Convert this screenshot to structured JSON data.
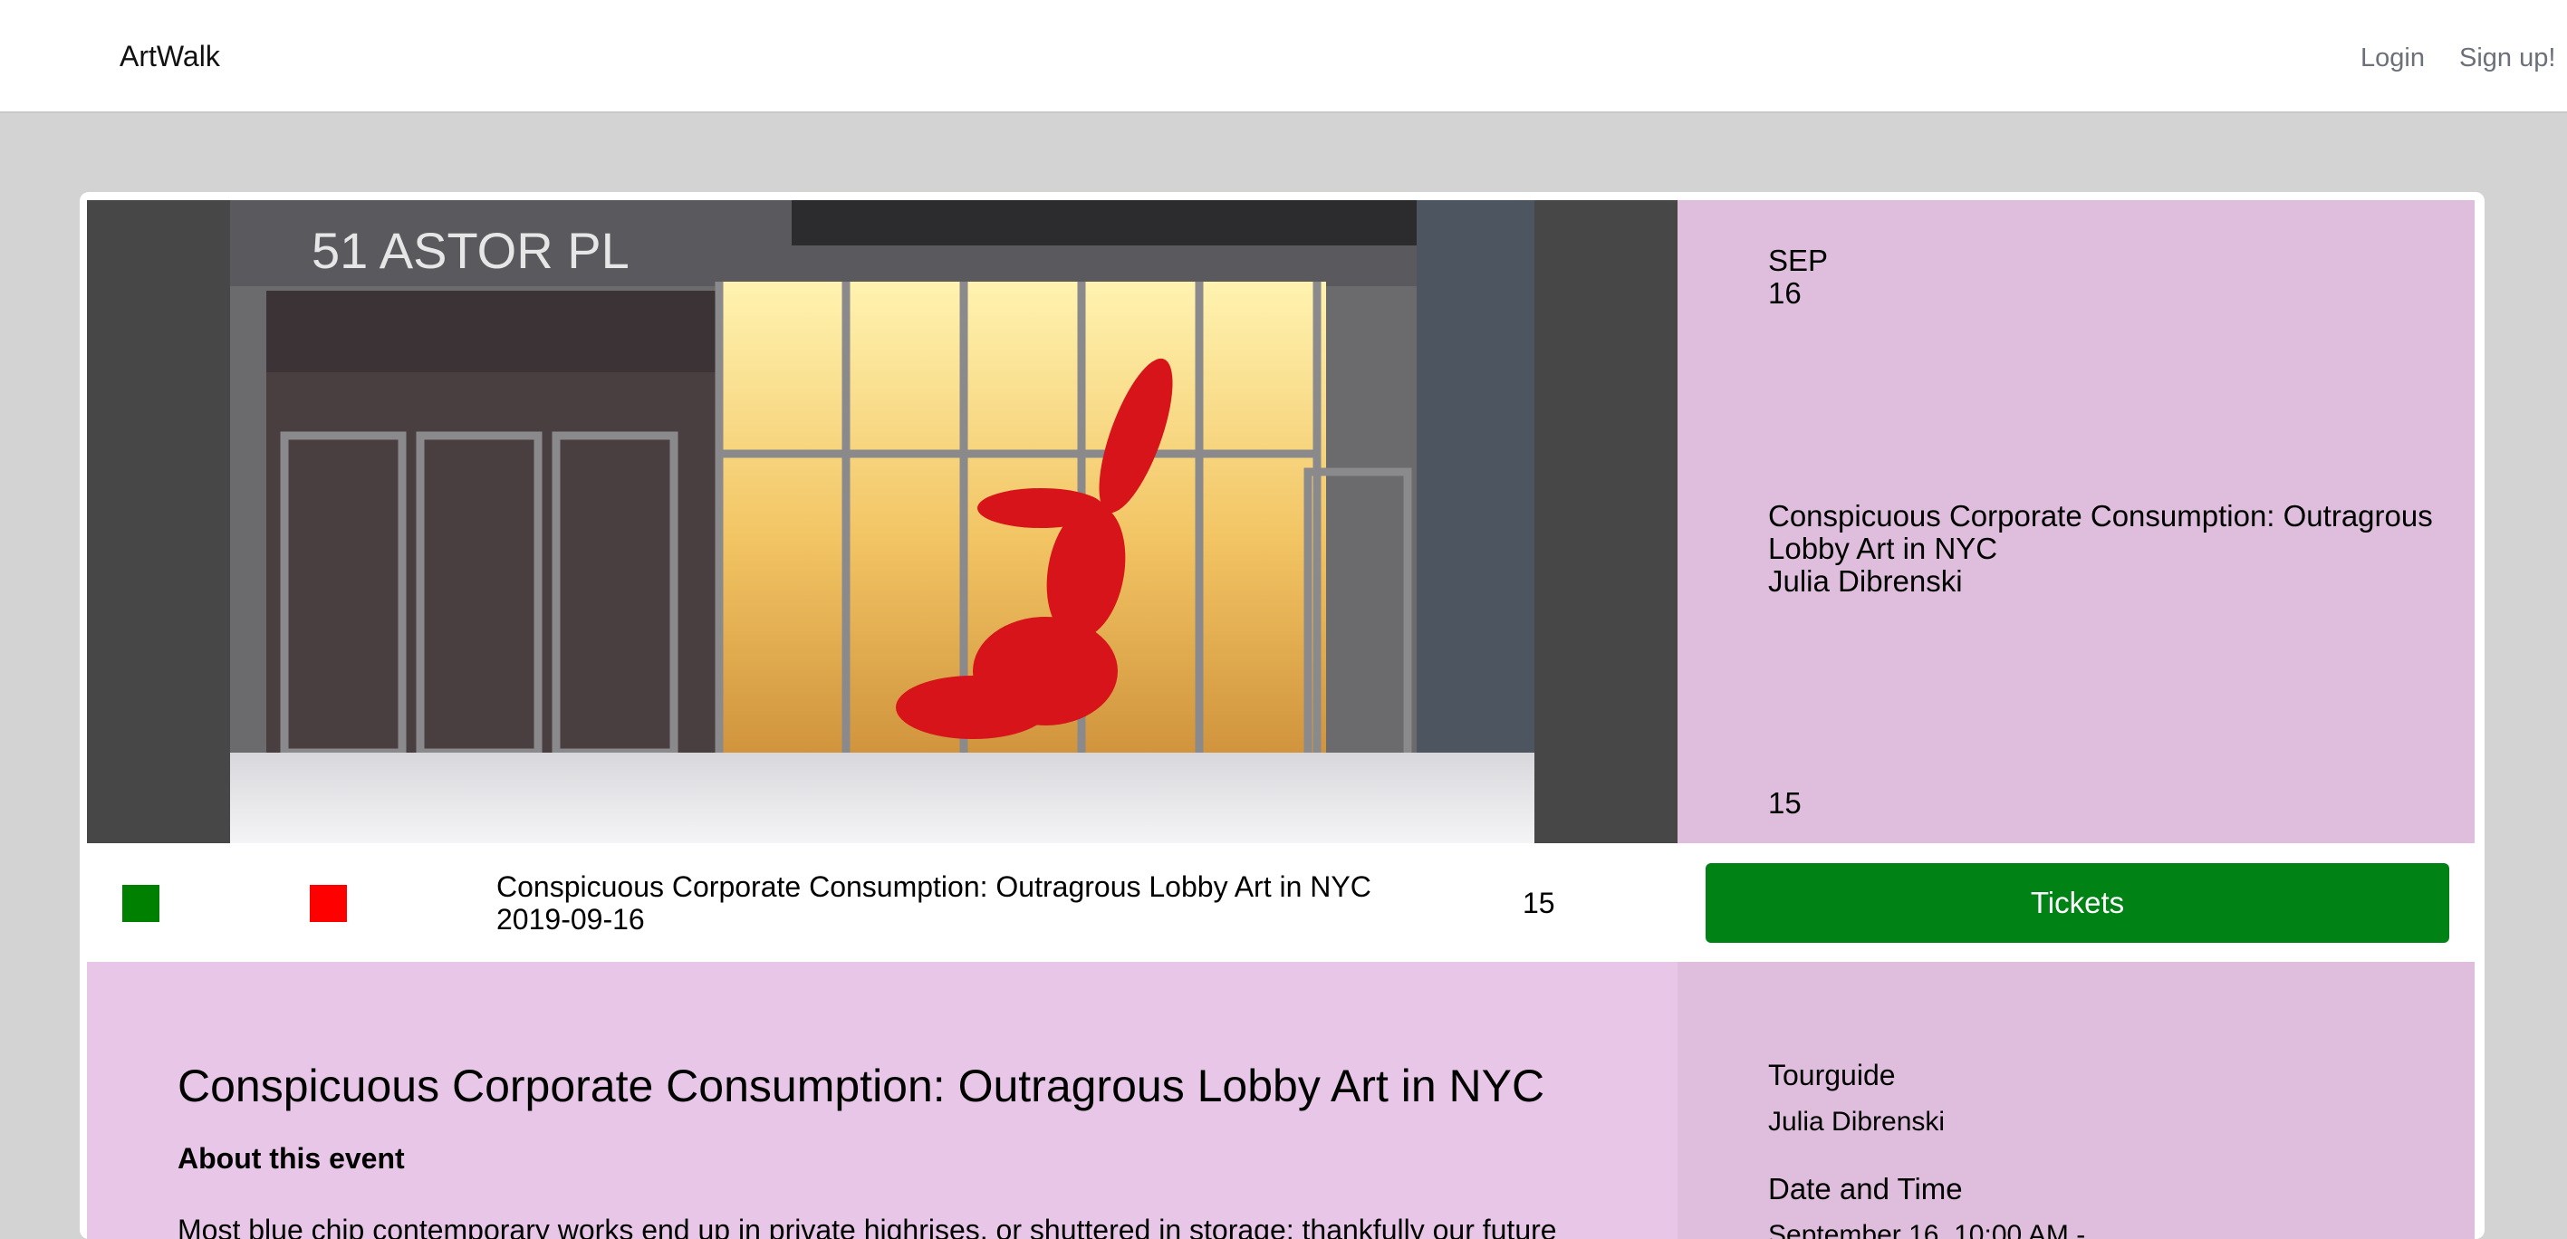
{
  "navbar": {
    "brand": "ArtWalk",
    "login_label": "Login",
    "signup_label": "Sign up!"
  },
  "hero": {
    "photo_caption_text": "51 ASTOR PL",
    "month": "SEP",
    "day": "16",
    "event_title": "Conspicuous Corporate Consumption: Outragrous Lobby Art in NYC",
    "guide_name": "Julia Dibrenski",
    "count": "15"
  },
  "strip": {
    "event_title": "Conspicuous Corporate Consumption: Outragrous Lobby Art in NYC",
    "date": "2019-09-16",
    "count": "15",
    "tickets_label": "Tickets"
  },
  "details": {
    "title": "Conspicuous Corporate Consumption: Outragrous Lobby Art in NYC",
    "about_heading": "About this event",
    "body_start": "Most blue chip contemporary works end up in private highrises, or shuttered in storage; thankfully our future"
  },
  "sidebar": {
    "tourguide_label": "Tourguide",
    "tourguide_name": "Julia Dibrenski",
    "datetime_label": "Date and Time",
    "datetime_value": "September 16, 10:00 AM -"
  },
  "colors": {
    "page_bg": "#d3d3d3",
    "accent_green": "#008215",
    "hero_info_bg": "#dfbddd",
    "description_bg": "#e8c6e7",
    "status_green": "#008000",
    "status_red": "#ff0000"
  }
}
